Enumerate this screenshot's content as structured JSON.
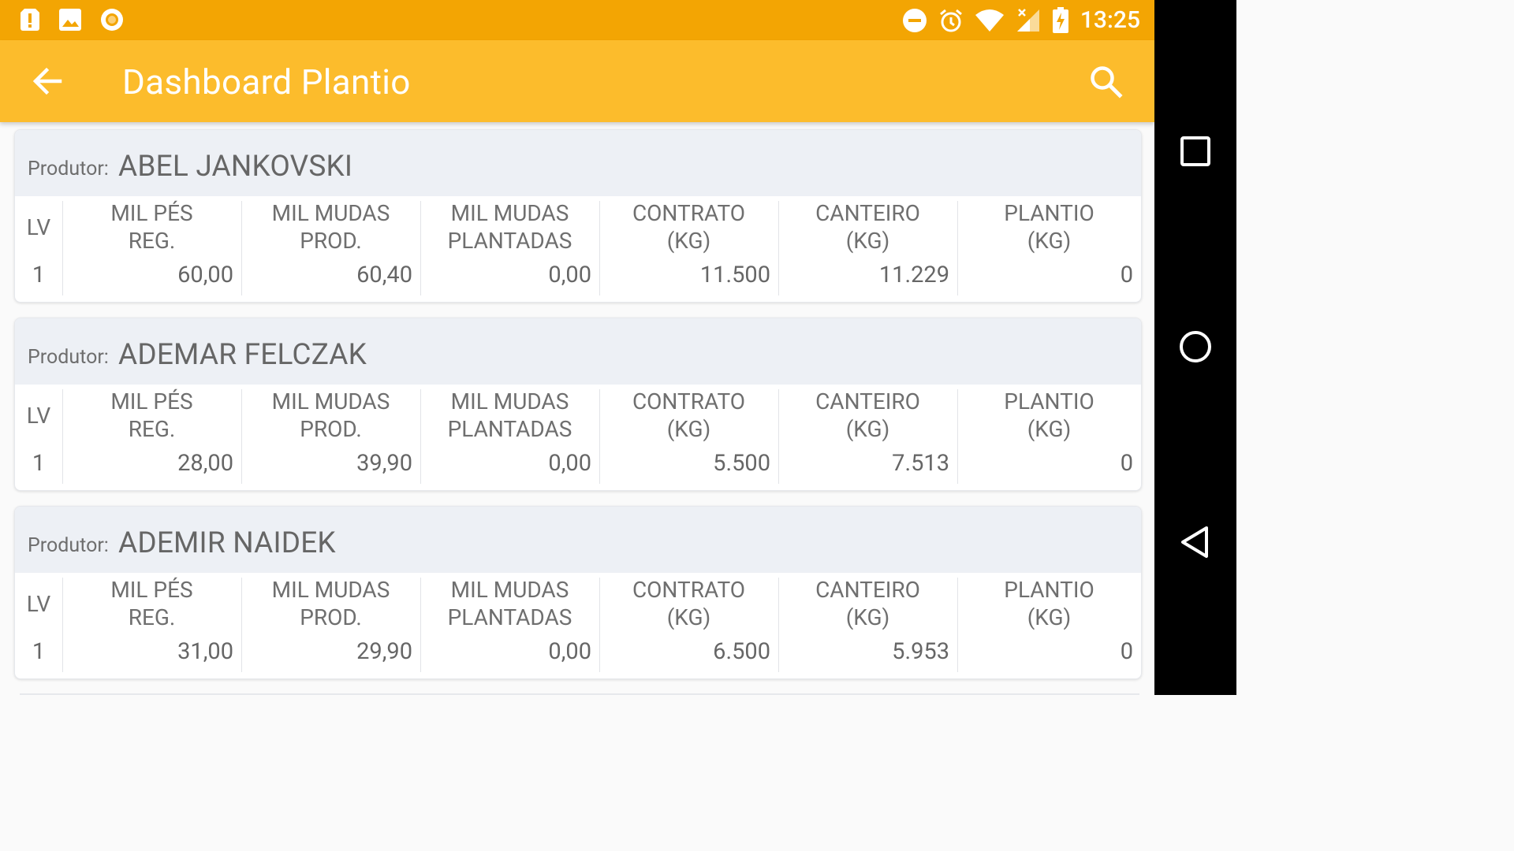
{
  "status_bar": {
    "time": "13:25",
    "left_icons": [
      "alert-icon",
      "image-icon",
      "record-icon"
    ],
    "right_icons": [
      "do-not-disturb-icon",
      "alarm-icon",
      "wifi-icon",
      "signal-icon",
      "battery-charging-icon"
    ]
  },
  "app_bar": {
    "title": "Dashboard Plantio",
    "back_icon": "arrow-back-icon",
    "search_icon": "search-icon"
  },
  "colors": {
    "status_bar": "#f3a503",
    "app_bar": "#fcbc2c",
    "card_header": "#edf0f5"
  },
  "columns": [
    "LV",
    "MIL PÉS\nREG.",
    "MIL MUDAS\nPROD.",
    "MIL MUDAS\nPLANTADAS",
    "CONTRATO\n(KG)",
    "CANTEIRO\n(KG)",
    "PLANTIO\n(KG)"
  ],
  "producer_label": "Produtor:",
  "producers": [
    {
      "name": "ABEL JANKOVSKI",
      "values": [
        "1",
        "60,00",
        "60,40",
        "0,00",
        "11.500",
        "11.229",
        "0"
      ]
    },
    {
      "name": "ADEMAR FELCZAK",
      "values": [
        "1",
        "28,00",
        "39,90",
        "0,00",
        "5.500",
        "7.513",
        "0"
      ]
    },
    {
      "name": "ADEMIR NAIDEK",
      "values": [
        "1",
        "31,00",
        "29,90",
        "0,00",
        "6.500",
        "5.953",
        "0"
      ]
    }
  ],
  "nav_bar": [
    "recents-icon",
    "home-icon",
    "back-icon"
  ]
}
